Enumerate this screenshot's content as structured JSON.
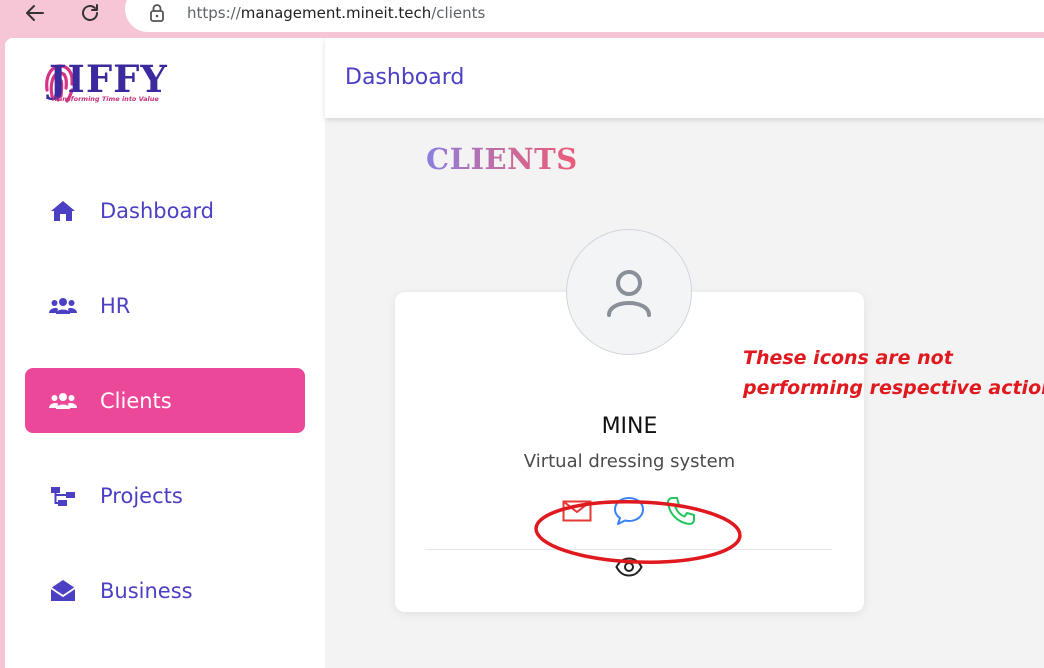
{
  "browser": {
    "url_scheme": "https://",
    "url_host": "management.mineit.tech",
    "url_path": "/clients"
  },
  "sidebar": {
    "logo_text": "JIFFY",
    "logo_tagline": "Transforming Time into Value",
    "items": [
      {
        "label": "Dashboard",
        "icon": "home-icon",
        "active": false
      },
      {
        "label": "HR",
        "icon": "users-icon",
        "active": false
      },
      {
        "label": "Clients",
        "icon": "users-icon",
        "active": true
      },
      {
        "label": "Projects",
        "icon": "sitemap-icon",
        "active": false
      },
      {
        "label": "Business",
        "icon": "envelope-open-icon",
        "active": false
      }
    ]
  },
  "header": {
    "title": "Dashboard"
  },
  "main": {
    "heading": "CLIENTS",
    "client_card": {
      "name": "MINE",
      "description": "Virtual dressing system",
      "actions": [
        "mail-icon",
        "chat-icon",
        "phone-icon"
      ],
      "view_icon": "eye-icon"
    }
  },
  "annotation": {
    "line1": "These icons are not",
    "line2": "performing respective action",
    "color": "#e0191f"
  },
  "colors": {
    "accent": "#ec4899",
    "nav_text": "#4b3fc4",
    "mail": "#e53935",
    "chat": "#3b82f6",
    "phone": "#22c55e"
  }
}
